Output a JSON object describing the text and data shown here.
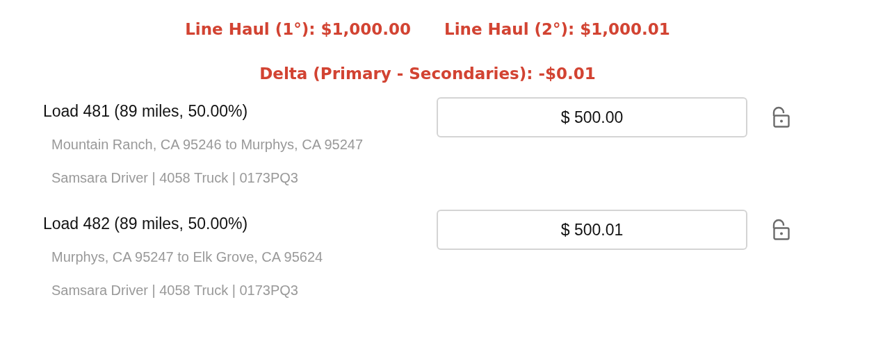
{
  "totals": [
    {
      "label": "Line Haul (1°): $1,000.00"
    },
    {
      "label": "Line Haul (2°): $1,000.01"
    }
  ],
  "delta": "Delta (Primary - Secondaries): -$0.01",
  "loads": [
    {
      "title": "Load 481 (89 miles, 50.00%)",
      "amount": "$ 500.00",
      "locked": false,
      "route": "Mountain Ranch, CA 95246 to Murphys, CA 95247",
      "assignment": "Samsara Driver | 4058 Truck | 0173PQ3"
    },
    {
      "title": "Load 482 (89 miles, 50.00%)",
      "amount": "$ 500.01",
      "locked": false,
      "route": "Murphys, CA 95247 to Elk Grove, CA 95624",
      "assignment": "Samsara Driver | 4058 Truck | 0173PQ3"
    }
  ]
}
